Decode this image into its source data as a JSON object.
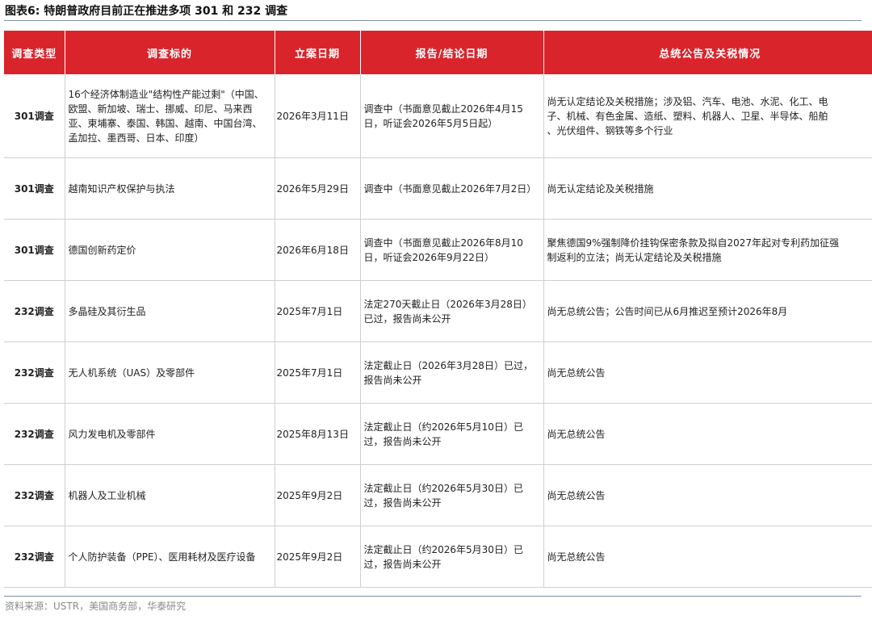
{
  "title": "图表6:  特朗普政府目前正在推进多项 301 和 232 调查",
  "table": {
    "headers": [
      "调查类型",
      "调查标的",
      "立案日期",
      "报告/结论日期",
      "总统公告及关税情况"
    ],
    "rows": [
      {
        "type": "301调查",
        "target": "16个经济体制造业\"结构性产能过剩\"（中国、欧盟、新加坡、瑞士、挪威、印尼、马来西亚、柬埔寨、泰国、韩国、越南、中国台湾、孟加拉、墨西哥、日本、印度）",
        "date": "2026年3月11日",
        "report": "调查中（书面意见截止2026年4月15日，听证会2026年5月5日起）",
        "notice_lines": [
          "尚无认定结论及关税措施；涉及铝、汽车、电池、水泥、化工、电",
          "子、机械、有色金属、造纸、塑料、机器人、卫星、半导体、船舶",
          "、光伏组件、钢铁等多个行业"
        ]
      },
      {
        "type": "301调查",
        "target": "越南知识产权保护与执法",
        "date": "2026年5月29日",
        "report": "调查中（书面意见截止2026年7月2日）",
        "notice_lines": [
          "尚无认定结论及关税措施"
        ]
      },
      {
        "type": "301调查",
        "target": "德国创新药定价",
        "date": "2026年6月18日",
        "report": "调查中（书面意见截止2026年8月10日，听证会2026年9月22日）",
        "notice_lines": [
          "聚焦德国9%强制降价挂钩保密条款及拟自2027年起对专利药加征强",
          "制返利的立法；尚无认定结论及关税措施"
        ]
      },
      {
        "type": "232调查",
        "target": "多晶硅及其衍生品",
        "date": "2025年7月1日",
        "report": "法定270天截止日（2026年3月28日）已过，报告尚未公开",
        "notice_lines": [
          "尚无总统公告；公告时间已从6月推迟至预计2026年8月"
        ]
      },
      {
        "type": "232调查",
        "target": "无人机系统（UAS）及零部件",
        "date": "2025年7月1日",
        "report": "法定截止日（2026年3月28日）已过，报告尚未公开",
        "notice_lines": [
          "尚无总统公告"
        ]
      },
      {
        "type": "232调查",
        "target": "风力发电机及零部件",
        "date": "2025年8月13日",
        "report": "法定截止日（约2026年5月10日）已过，报告尚未公开",
        "notice_lines": [
          "尚无总统公告"
        ]
      },
      {
        "type": "232调查",
        "target": "机器人及工业机械",
        "date": "2025年9月2日",
        "report": "法定截止日（约2026年5月30日）已过，报告尚未公开",
        "notice_lines": [
          "尚无总统公告"
        ]
      },
      {
        "type": "232调查",
        "target": "个人防护装备（PPE）、医用耗材及医疗设备",
        "date": "2025年9月2日",
        "report": "法定截止日（约2026年5月30日）已过，报告尚未公开",
        "notice_lines": [
          "尚无总统公告"
        ]
      }
    ]
  },
  "source": "资料来源：USTR，美国商务部，华泰研究",
  "colors": {
    "header_bg": "#d9242b",
    "header_text": "#ffffff",
    "rule": "#7f8fa6"
  }
}
